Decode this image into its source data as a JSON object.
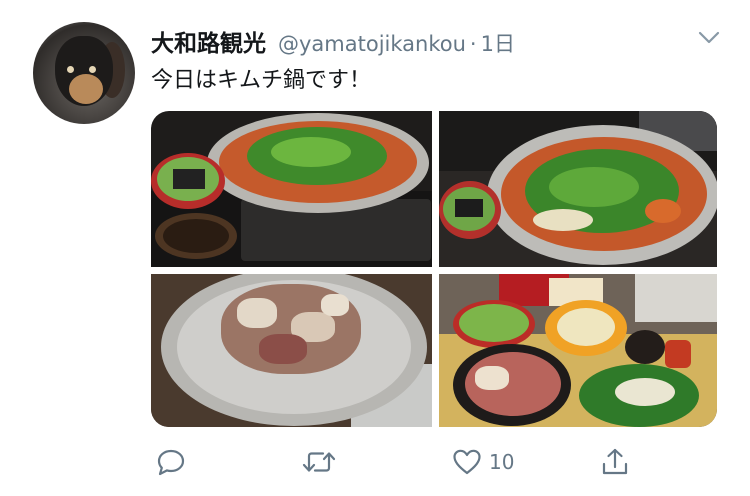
{
  "tweet": {
    "display_name": "大和路観光",
    "handle": "@yamatojikankou",
    "separator": "·",
    "time": "1日",
    "text": "今日はキムチ鍋です！"
  },
  "media": {
    "photos": [
      {
        "subject": "kimchi-hotpot-on-burner"
      },
      {
        "subject": "kimchi-hotpot-closeup"
      },
      {
        "subject": "meat-in-empty-pot"
      },
      {
        "subject": "table-spread-ingredients"
      }
    ]
  },
  "actions": {
    "reply_icon": "reply-icon",
    "retweet_icon": "retweet-icon",
    "like_icon": "heart-icon",
    "like_count": "10",
    "share_icon": "share-icon"
  },
  "colors": {
    "text_primary": "#14171a",
    "text_secondary": "#657786",
    "background": "#ffffff"
  }
}
